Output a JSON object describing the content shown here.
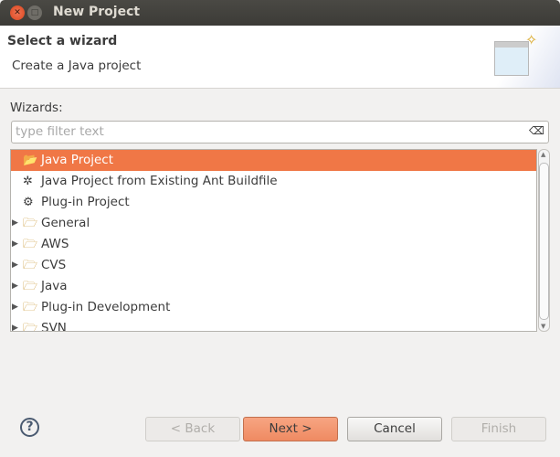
{
  "window": {
    "title": "New Project"
  },
  "header": {
    "title": "Select a wizard",
    "subtitle": "Create a Java project"
  },
  "wizards": {
    "label": "Wizards:",
    "filter_placeholder": "type filter text",
    "items": [
      {
        "label": "Java Project",
        "icon": "java-project-icon",
        "selected": true,
        "expandable": false
      },
      {
        "label": "Java Project from Existing Ant Buildfile",
        "icon": "ant-icon",
        "expandable": false
      },
      {
        "label": "Plug-in Project",
        "icon": "plugin-project-icon",
        "expandable": false
      },
      {
        "label": "General",
        "icon": "folder-icon",
        "expandable": true
      },
      {
        "label": "AWS",
        "icon": "folder-icon",
        "expandable": true
      },
      {
        "label": "CVS",
        "icon": "folder-icon",
        "expandable": true
      },
      {
        "label": "Java",
        "icon": "folder-icon",
        "expandable": true
      },
      {
        "label": "Plug-in Development",
        "icon": "folder-icon",
        "expandable": true
      },
      {
        "label": "SVN",
        "icon": "folder-icon",
        "expandable": true
      }
    ]
  },
  "buttons": {
    "back": "< Back",
    "next": "Next >",
    "cancel": "Cancel",
    "finish": "Finish"
  },
  "colors": {
    "selection": "#f07746",
    "titlebar": "#3c3b37"
  }
}
